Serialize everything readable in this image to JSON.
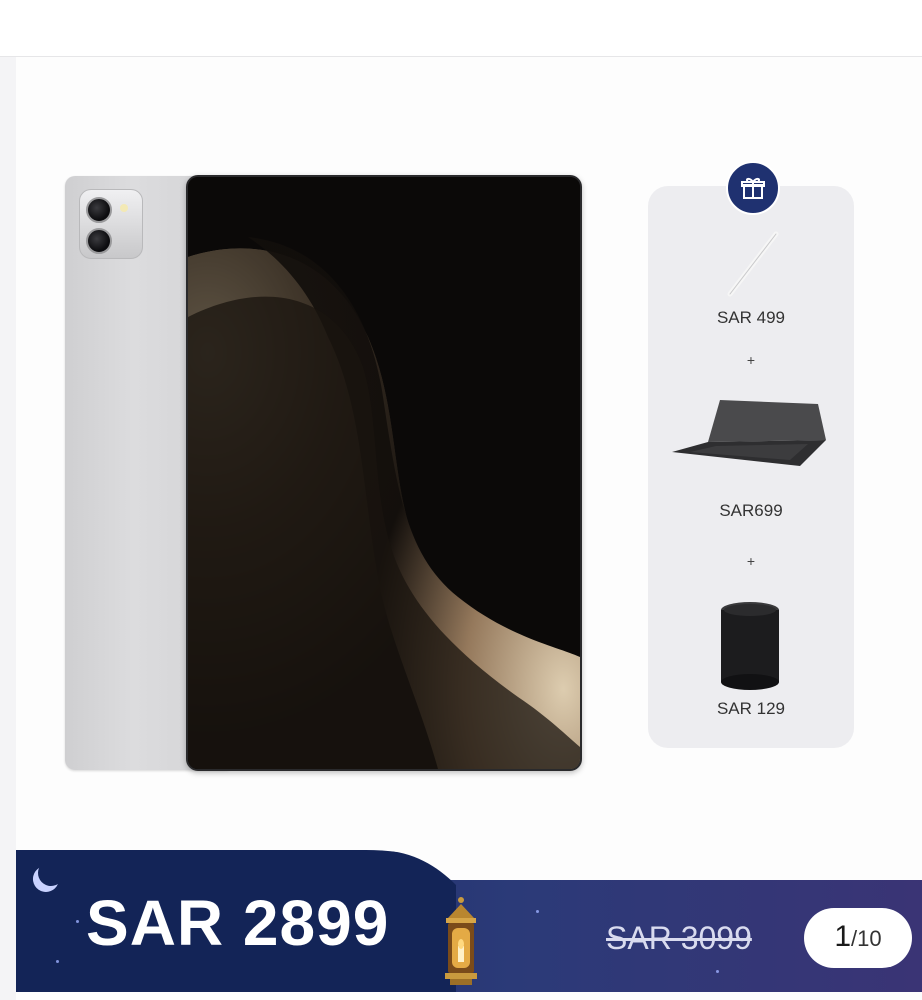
{
  "product": {
    "name": "",
    "current_price": "SAR 2899",
    "original_price": "SAR 3099"
  },
  "bundle": {
    "items": [
      {
        "name": "stylus-pen",
        "price": "SAR 499"
      },
      {
        "name": "keyboard-case",
        "price": "SAR699"
      },
      {
        "name": "mini-speaker",
        "price": "SAR 129"
      }
    ],
    "plus": "+"
  },
  "pager": {
    "current": "1",
    "separator": "/",
    "total": "10"
  },
  "colors": {
    "banner_dark": "#132457",
    "banner_mid": "#2b3a78",
    "gift_badge": "#1f3170",
    "card_bg": "#ededf0"
  },
  "icons": {
    "gift": "gift-icon",
    "moon": "crescent-moon-icon",
    "lantern": "lantern-icon"
  }
}
